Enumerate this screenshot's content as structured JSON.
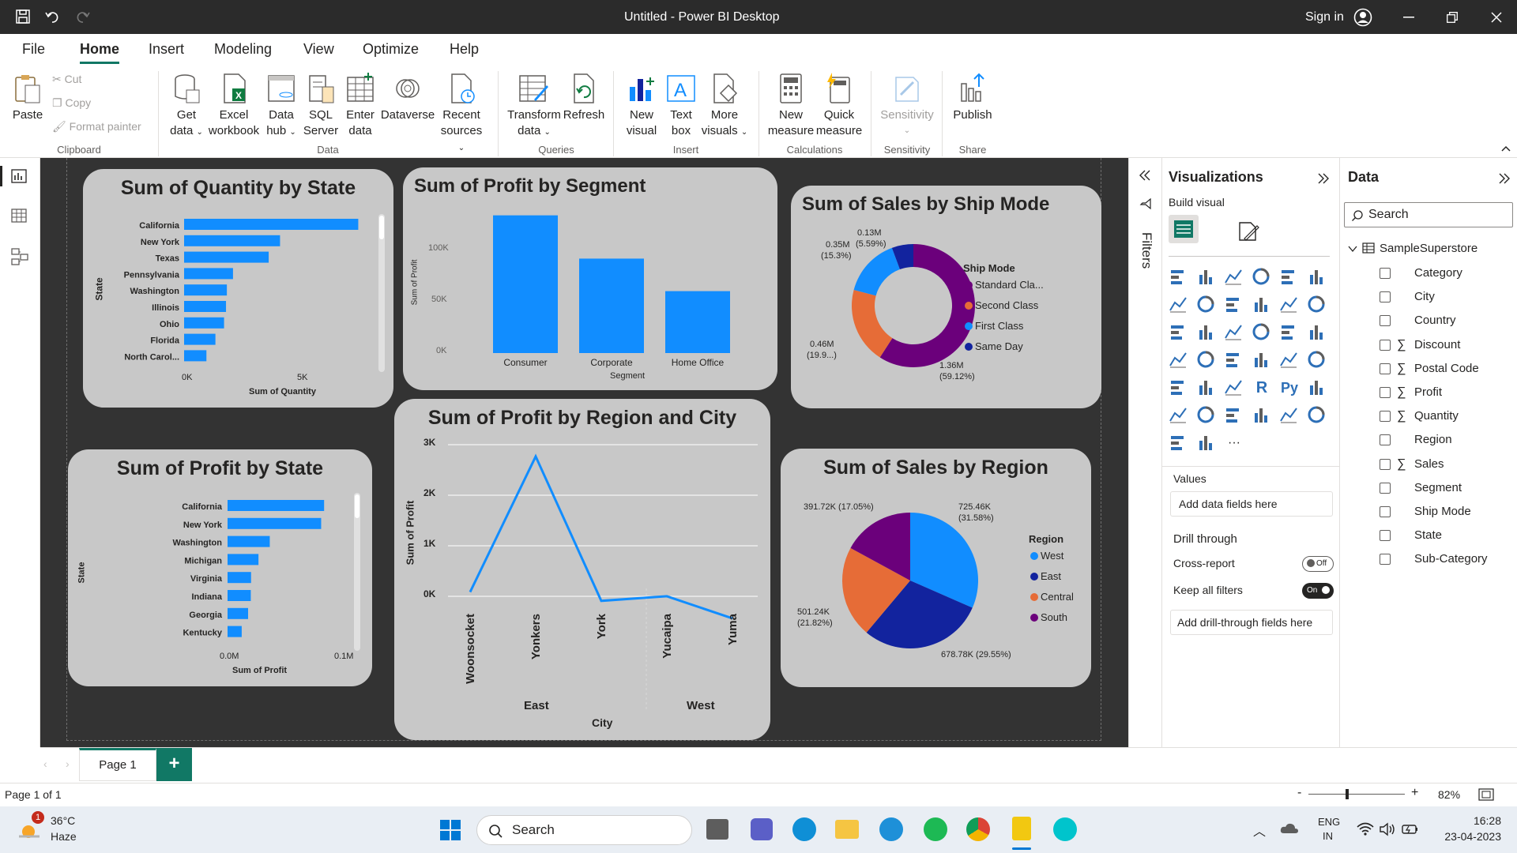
{
  "window": {
    "title": "Untitled - Power BI Desktop",
    "sign_in": "Sign in"
  },
  "menu": [
    "File",
    "Home",
    "Insert",
    "Modeling",
    "View",
    "Optimize",
    "Help"
  ],
  "ribbon": {
    "clipboard": {
      "paste": "Paste",
      "cut": "Cut",
      "copy": "Copy",
      "format_painter": "Format painter",
      "group": "Clipboard"
    },
    "data": {
      "get_data_1": "Get",
      "get_data_2": "data",
      "excel_1": "Excel",
      "excel_2": "workbook",
      "hub_1": "Data",
      "hub_2": "hub",
      "sql_1": "SQL",
      "sql_2": "Server",
      "enter_1": "Enter",
      "enter_2": "data",
      "dataverse": "Dataverse",
      "recent_1": "Recent",
      "recent_2": "sources",
      "group": "Data"
    },
    "queries": {
      "transform_1": "Transform",
      "transform_2": "data",
      "refresh": "Refresh",
      "group": "Queries"
    },
    "insert": {
      "new_visual_1": "New",
      "new_visual_2": "visual",
      "text_box_1": "Text",
      "text_box_2": "box",
      "more_1": "More",
      "more_2": "visuals",
      "group": "Insert"
    },
    "calculations": {
      "new_measure_1": "New",
      "new_measure_2": "measure",
      "quick_1": "Quick",
      "quick_2": "measure",
      "group": "Calculations"
    },
    "sensitivity": {
      "label": "Sensitivity",
      "group": "Sensitivity"
    },
    "share": {
      "publish": "Publish",
      "group": "Share"
    }
  },
  "charts": {
    "qty_state": {
      "title": "Sum of Quantity by State",
      "ylabel": "State",
      "xlabel": "Sum of Quantity",
      "ticks": [
        "0K",
        "5K"
      ]
    },
    "profit_segment": {
      "title": "Sum of Profit by Segment",
      "ylabel": "Sum of Profit",
      "xlabel": "Segment",
      "ticks": [
        "100K",
        "50K",
        "0K"
      ]
    },
    "sales_ship": {
      "title": "Sum of Sales by Ship Mode",
      "legend_title": "Ship Mode",
      "labels": [
        "0.13M",
        "(5.59%)",
        "0.35M",
        "(15.3%)",
        "0.46M",
        "(19.9...)",
        "1.36M",
        "(59.12%)"
      ]
    },
    "profit_state": {
      "title": "Sum of Profit by State",
      "ylabel": "State",
      "xlabel": "Sum of Profit",
      "ticks": [
        "0.0M",
        "0.1M"
      ]
    },
    "profit_region_city": {
      "title": "Sum of Profit by Region and City",
      "ylabel": "Sum of Profit",
      "xlabel": "City",
      "ticks": [
        "3K",
        "2K",
        "1K",
        "0K"
      ],
      "regions": [
        "East",
        "West"
      ]
    },
    "sales_region": {
      "title": "Sum of Sales by Region",
      "legend_title": "Region",
      "labels": [
        "391.72K (17.05%)",
        "725.46K",
        "(31.58%)",
        "501.24K",
        "(21.82%)",
        "678.78K (29.55%)"
      ]
    }
  },
  "chart_data": [
    {
      "type": "bar",
      "title": "Sum of Quantity by State",
      "orientation": "horizontal",
      "categories": [
        "California",
        "New York",
        "Texas",
        "Pennsylvania",
        "Washington",
        "Illinois",
        "Ohio",
        "Florida",
        "North Carol..."
      ],
      "values": [
        7667,
        4224,
        3724,
        2153,
        1883,
        1845,
        1759,
        1379,
        983
      ],
      "xlim": [
        0,
        8000
      ],
      "color": "#118dff"
    },
    {
      "type": "bar",
      "title": "Sum of Profit by Segment",
      "categories": [
        "Consumer",
        "Corporate",
        "Home Office"
      ],
      "values": [
        134119,
        91979,
        60299
      ],
      "ylim": [
        0,
        150000
      ],
      "color": "#118dff"
    },
    {
      "type": "pie",
      "title": "Sum of Sales by Ship Mode",
      "donut": true,
      "categories": [
        "Standard Cla...",
        "Second Class",
        "First Class",
        "Same Day"
      ],
      "values": [
        1.36,
        0.46,
        0.35,
        0.13
      ],
      "percent": [
        59.12,
        19.9,
        15.3,
        5.59
      ],
      "colors": [
        "#6b007b",
        "#e66c37",
        "#118dff",
        "#12239e"
      ]
    },
    {
      "type": "bar",
      "title": "Sum of Profit by State",
      "orientation": "horizontal",
      "categories": [
        "California",
        "New York",
        "Washington",
        "Michigan",
        "Virginia",
        "Indiana",
        "Georgia",
        "Kentucky"
      ],
      "values": [
        76381,
        74039,
        33403,
        24463,
        18598,
        18383,
        16250,
        11200
      ],
      "xlim": [
        0,
        100000
      ],
      "color": "#118dff"
    },
    {
      "type": "line",
      "title": "Sum of Profit by Region and City",
      "categories": [
        "Woonsocket",
        "Yonkers",
        "York",
        "Yucaipa",
        "Yuma"
      ],
      "groups": [
        {
          "name": "East",
          "cities": [
            "Woonsocket",
            "Yonkers",
            "York"
          ]
        },
        {
          "name": "West",
          "cities": [
            "Yucaipa",
            "Yuma"
          ]
        }
      ],
      "values": [
        85,
        2767,
        -90,
        1,
        -437
      ],
      "ylim": [
        -500,
        3000
      ],
      "color": "#118dff"
    },
    {
      "type": "pie",
      "title": "Sum of Sales by Region",
      "categories": [
        "West",
        "East",
        "Central",
        "South"
      ],
      "values": [
        725.46,
        678.78,
        501.24,
        391.72
      ],
      "percent": [
        31.58,
        29.55,
        21.82,
        17.05
      ],
      "colors": [
        "#118dff",
        "#12239e",
        "#e66c37",
        "#6b007b"
      ]
    }
  ],
  "side": {
    "filters": "Filters"
  },
  "viz_pane": {
    "title": "Visualizations",
    "build": "Build visual",
    "values": "Values",
    "add_fields": "Add data fields here",
    "drill": "Drill through",
    "cross": "Cross-report",
    "cross_state": "Off",
    "keep": "Keep all filters",
    "keep_state": "On",
    "add_drill": "Add drill-through fields here"
  },
  "data_pane": {
    "title": "Data",
    "search": "Search",
    "table": "SampleSuperstore",
    "fields": [
      {
        "name": "Category",
        "sigma": false
      },
      {
        "name": "City",
        "sigma": false
      },
      {
        "name": "Country",
        "sigma": false
      },
      {
        "name": "Discount",
        "sigma": true
      },
      {
        "name": "Postal Code",
        "sigma": true
      },
      {
        "name": "Profit",
        "sigma": true
      },
      {
        "name": "Quantity",
        "sigma": true
      },
      {
        "name": "Region",
        "sigma": false
      },
      {
        "name": "Sales",
        "sigma": true
      },
      {
        "name": "Segment",
        "sigma": false
      },
      {
        "name": "Ship Mode",
        "sigma": false
      },
      {
        "name": "State",
        "sigma": false
      },
      {
        "name": "Sub-Category",
        "sigma": false
      }
    ]
  },
  "pages": {
    "tab": "Page 1",
    "status": "Page 1 of 1",
    "zoom": "82%"
  },
  "taskbar": {
    "temp": "36°C",
    "weather": "Haze",
    "badge": "1",
    "search": "Search",
    "lang1": "ENG",
    "lang2": "IN",
    "time": "16:28",
    "date": "23-04-2023"
  }
}
